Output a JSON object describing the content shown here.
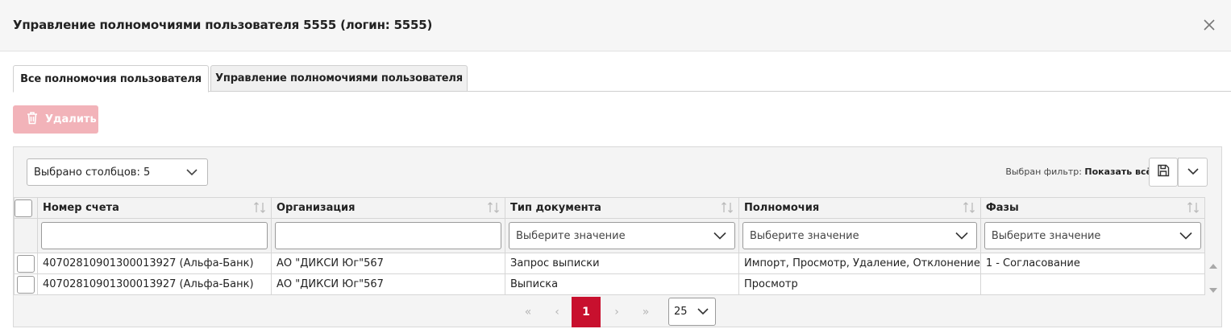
{
  "dialog": {
    "title": "Управление полномочиями пользователя 5555 (логин: 5555)"
  },
  "tabs": [
    {
      "label": "Все полномочия пользователя",
      "active": true
    },
    {
      "label": "Управление полномочиями пользователя",
      "active": false
    }
  ],
  "toolbar": {
    "delete_label": "Удалить"
  },
  "grid": {
    "columns_selected": "Выбрано столбцов: 5",
    "filter_prefix": "Выбран фильтр:",
    "filter_value": "Показать всё",
    "columns": [
      {
        "label": "Номер счета"
      },
      {
        "label": "Организация"
      },
      {
        "label": "Тип документа"
      },
      {
        "label": "Полномочия"
      },
      {
        "label": "Фазы"
      }
    ],
    "filter_placeholder": "Выберите значение",
    "rows": [
      {
        "account": "40702810901300013927 (Альфа-Банк)",
        "org": "АО \"ДИКСИ Юг\"567",
        "doc_type": "Запрос выписки",
        "permissions": "Импорт, Просмотр, Удаление, Отклонение",
        "phases": "1 - Согласование"
      },
      {
        "account": "40702810901300013927 (Альфа-Банк)",
        "org": "АО \"ДИКСИ Юг\"567",
        "doc_type": "Выписка",
        "permissions": "Просмотр",
        "phases": ""
      }
    ]
  },
  "pager": {
    "first": "«",
    "prev": "‹",
    "current": "1",
    "next": "›",
    "last": "»",
    "page_size": "25"
  },
  "colors": {
    "accent": "#c8102e",
    "delete_disabled": "#f2b3b9"
  }
}
